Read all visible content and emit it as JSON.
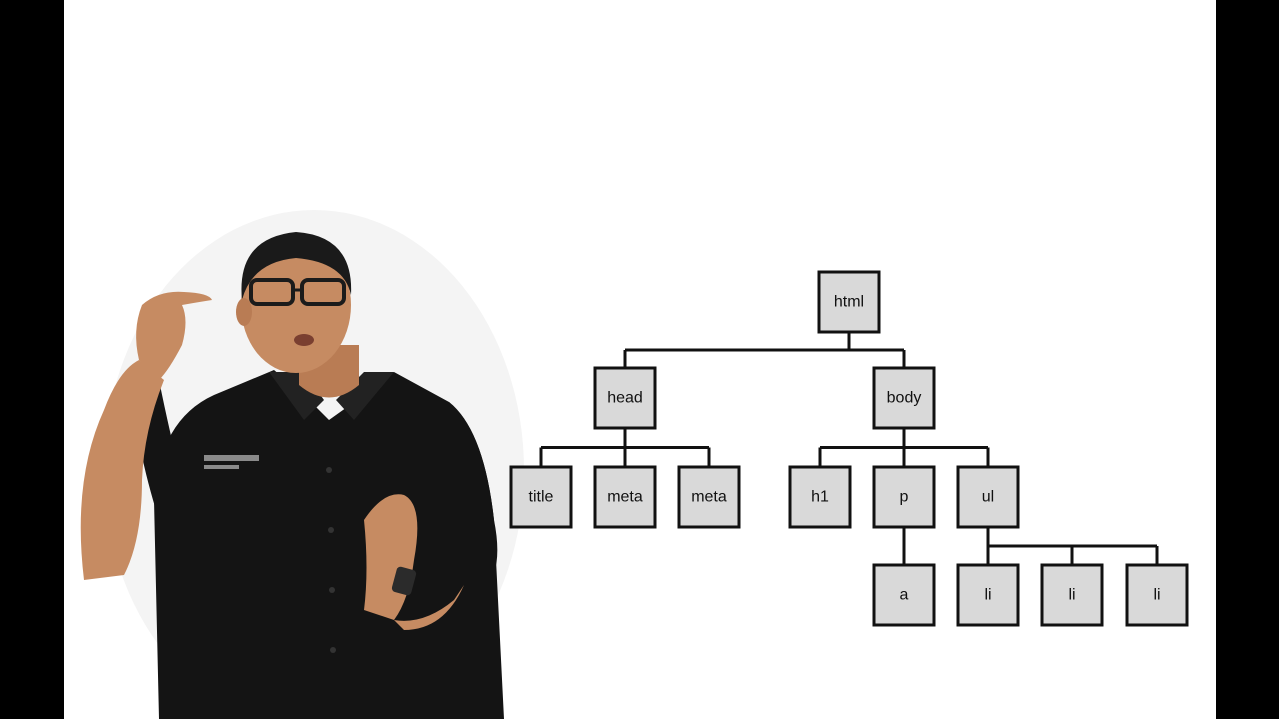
{
  "slide": {
    "background_color": "#ffffff",
    "letterbox_color": "#000000"
  },
  "presenter": {
    "icon": "presenter-figure",
    "shirt_color": "#141414",
    "skin_color": "#c68b62"
  },
  "dom_tree": {
    "box_fill": "#d9d9d9",
    "line_color": "#111111",
    "nodes": [
      {
        "id": "html",
        "label": "html",
        "parent": null
      },
      {
        "id": "head",
        "label": "head",
        "parent": "html"
      },
      {
        "id": "body",
        "label": "body",
        "parent": "html"
      },
      {
        "id": "title",
        "label": "title",
        "parent": "head"
      },
      {
        "id": "meta1",
        "label": "meta",
        "parent": "head"
      },
      {
        "id": "meta2",
        "label": "meta",
        "parent": "head"
      },
      {
        "id": "h1",
        "label": "h1",
        "parent": "body"
      },
      {
        "id": "p",
        "label": "p",
        "parent": "body"
      },
      {
        "id": "ul",
        "label": "ul",
        "parent": "body"
      },
      {
        "id": "a",
        "label": "a",
        "parent": "p"
      },
      {
        "id": "li1",
        "label": "li",
        "parent": "ul"
      },
      {
        "id": "li2",
        "label": "li",
        "parent": "ul"
      },
      {
        "id": "li3",
        "label": "li",
        "parent": "ul"
      }
    ]
  },
  "watermark": {
    "icon": "channel-logo-icon"
  }
}
